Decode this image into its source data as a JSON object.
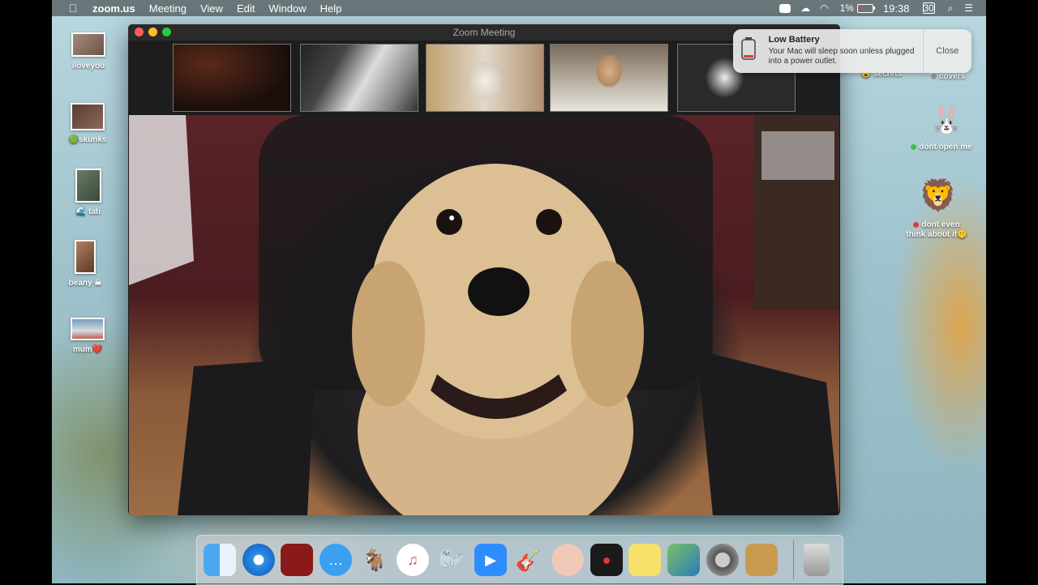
{
  "menubar": {
    "apple_icon": "apple-icon",
    "app_name": "zoom.us",
    "menus": [
      "Meeting",
      "View",
      "Edit",
      "Window",
      "Help"
    ],
    "battery_percent": "1%",
    "time": "19:38",
    "calendar_day": "30",
    "status_icons": [
      "zoom-icon",
      "creative-cloud-icon",
      "wifi-icon",
      "battery-icon",
      "calendar-icon",
      "spotlight-search-icon",
      "control-center-icon"
    ]
  },
  "desktop": {
    "left_icons": [
      {
        "label": "iloveyou"
      },
      {
        "label": "skunks",
        "emoji": "🟢"
      },
      {
        "label": "tati",
        "emoji": "🌊"
      },
      {
        "label": "beany",
        "emoji": "☠"
      },
      {
        "label": "mum",
        "emoji": "❤️"
      }
    ],
    "right_icons": [
      {
        "label": "secrets",
        "emoji": "😮"
      },
      {
        "label": "covers",
        "dot_color": "#9a9a9a"
      },
      {
        "label": "dont open me",
        "dot_color": "#3bc24a"
      },
      {
        "label_line1": "dont even",
        "label_line2": "think about it",
        "emoji": "🤫",
        "dot_color": "#e0383e"
      }
    ]
  },
  "zoom_window": {
    "title": "Zoom Meeting",
    "participant_tiles": [
      {
        "name": "participant-1",
        "desc": "dark video"
      },
      {
        "name": "participant-2",
        "desc": "dog closeup"
      },
      {
        "name": "participant-3",
        "desc": "white dog"
      },
      {
        "name": "participant-4",
        "desc": "woman"
      },
      {
        "name": "participant-5",
        "desc": "husky"
      }
    ],
    "active_speaker": "dog on office chair"
  },
  "notification": {
    "title": "Low Battery",
    "body": "Your Mac will sleep soon unless plugged into a power outlet.",
    "close_label": "Close"
  },
  "dock": {
    "apps": [
      "finder-icon",
      "safari-icon",
      "photo-booth-icon",
      "messages-icon",
      "goat-app-icon",
      "itunes-icon",
      "seal-app-icon",
      "zoom-icon",
      "garageband-icon",
      "face-app-icon",
      "photo-app-icon",
      "stickies-icon",
      "preview-icon",
      "system-preferences-icon",
      "contacts-icon"
    ],
    "trash": "trash-icon"
  }
}
